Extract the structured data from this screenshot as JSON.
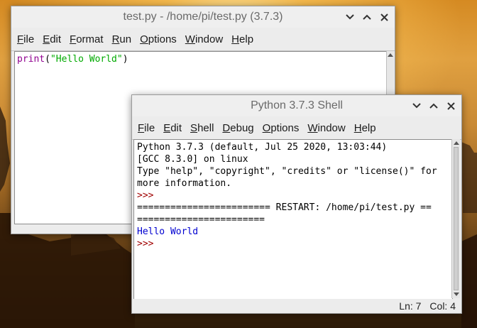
{
  "editor": {
    "title": "test.py - /home/pi/test.py (3.7.3)",
    "menu": [
      {
        "underline": "F",
        "rest": "ile"
      },
      {
        "underline": "E",
        "rest": "dit"
      },
      {
        "underline": "F",
        "rest": "ormat"
      },
      {
        "underline": "R",
        "rest": "un"
      },
      {
        "underline": "O",
        "rest": "ptions"
      },
      {
        "underline": "W",
        "rest": "indow"
      },
      {
        "underline": "H",
        "rest": "elp"
      }
    ],
    "code": {
      "fn": "print",
      "open": "(",
      "str": "\"Hello World\"",
      "close": ")"
    }
  },
  "shell": {
    "title": "Python 3.7.3 Shell",
    "menu": [
      {
        "underline": "F",
        "rest": "ile"
      },
      {
        "underline": "E",
        "rest": "dit"
      },
      {
        "underline": "",
        "rest": "Shell",
        "mid": "S",
        "pre": "",
        "post": "hell"
      },
      {
        "underline": "D",
        "rest": "ebug"
      },
      {
        "underline": "O",
        "rest": "ptions"
      },
      {
        "underline": "W",
        "rest": "indow"
      },
      {
        "underline": "H",
        "rest": "elp"
      }
    ],
    "lines": [
      {
        "text": "Python 3.7.3 (default, Jul 25 2020, 13:03:44)",
        "kind": "out"
      },
      {
        "text": "[GCC 8.3.0] on linux",
        "kind": "out"
      },
      {
        "text": "Type \"help\", \"copyright\", \"credits\" or \"license()\" for",
        "kind": "out"
      },
      {
        "text": "more information.",
        "kind": "out"
      },
      {
        "text": ">>>",
        "kind": "prompt"
      },
      {
        "text": "======================== RESTART: /home/pi/test.py ==",
        "kind": "out"
      },
      {
        "text": "=======================",
        "kind": "out"
      },
      {
        "text": "Hello World",
        "kind": "stdout"
      },
      {
        "text": ">>>",
        "kind": "prompt"
      }
    ],
    "status": {
      "line": "Ln: 7",
      "col": "Col: 4"
    }
  },
  "colors": {
    "keyword": "#900090",
    "string": "#00aa00",
    "prompt": "#a00000",
    "stdout": "#0000d0"
  },
  "icons": {
    "minimize": "chevron-down-icon",
    "maximize": "chevron-up-icon",
    "close": "close-icon"
  }
}
